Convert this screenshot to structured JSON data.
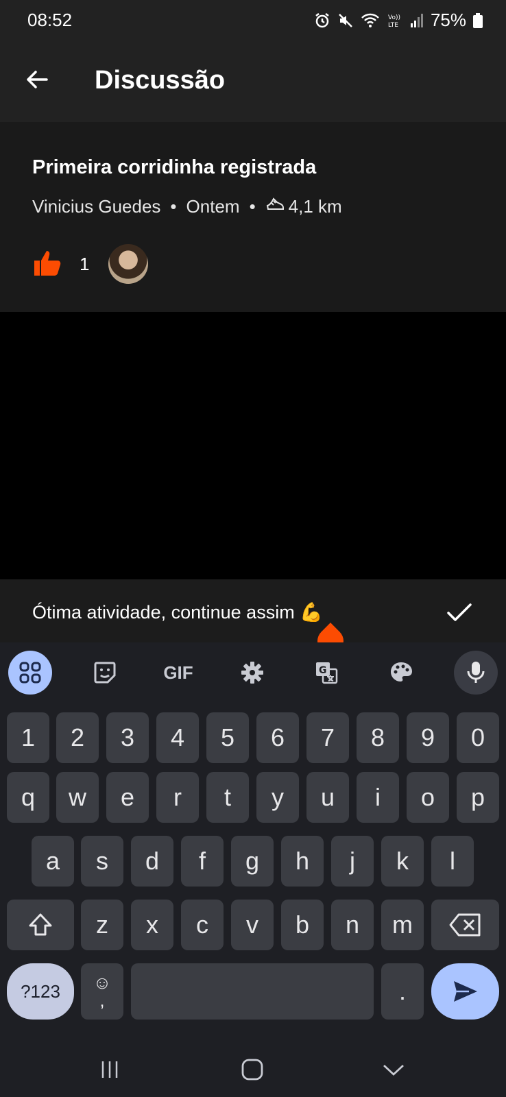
{
  "status_bar": {
    "time": "08:52",
    "battery": "75%",
    "icons": [
      "alarm-icon",
      "mute-icon",
      "wifi-icon",
      "volte-icon",
      "signal-icon",
      "battery-icon"
    ]
  },
  "header": {
    "title": "Discussão"
  },
  "activity": {
    "title": "Primeira corridinha registrada",
    "athlete": "Vinicius Guedes",
    "separator": "•",
    "date": "Ontem",
    "distance": "4,1 km",
    "kudos_count": "1"
  },
  "comment": {
    "text": "Ótima atividade, continue assim 💪"
  },
  "keyboard": {
    "toolbar": [
      "apps-grid-icon",
      "sticker-icon",
      "GIF",
      "settings-icon",
      "translate-icon",
      "palette-icon",
      "mic-icon"
    ],
    "gif_label": "GIF",
    "row_numbers": [
      "1",
      "2",
      "3",
      "4",
      "5",
      "6",
      "7",
      "8",
      "9",
      "0"
    ],
    "row_top": [
      "q",
      "w",
      "e",
      "r",
      "t",
      "y",
      "u",
      "i",
      "o",
      "p"
    ],
    "row_middle": [
      "a",
      "s",
      "d",
      "f",
      "g",
      "h",
      "j",
      "k",
      "l"
    ],
    "row_bottom": [
      "z",
      "x",
      "c",
      "v",
      "b",
      "n",
      "m"
    ],
    "symbols_label": "?123",
    "comma_label": ",",
    "period_label": ".",
    "emoji_label": "☺"
  },
  "colors": {
    "accent": "#fc4c02",
    "keyboard_accent": "#aac4ff",
    "key_bg": "#3b3d43"
  }
}
